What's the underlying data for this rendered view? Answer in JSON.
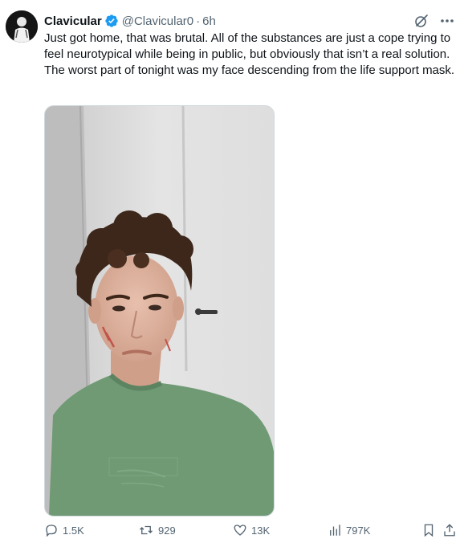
{
  "author": {
    "name": "Clavicular",
    "handle": "@Clavicular0",
    "separator": "·",
    "time": "6h"
  },
  "tweet": {
    "text": "Just got home, that was brutal. All of the substances are just a cope trying to feel neurotypical while being in public, but obviously that isn’t a real solution. The worst part of tonight was my face descending from the life support mask."
  },
  "metrics": {
    "replies": "1.5K",
    "reposts": "929",
    "likes": "13K",
    "views": "797K"
  },
  "icons": [
    "avatar",
    "verified-badge-icon",
    "grok-icon",
    "more-icon",
    "reply-icon",
    "repost-icon",
    "like-icon",
    "views-icon",
    "bookmark-icon",
    "share-icon"
  ],
  "colors": {
    "text": "#0f1419",
    "secondary": "#536471",
    "verified": "#1d9bf0",
    "shirt": "#6f9a74"
  }
}
